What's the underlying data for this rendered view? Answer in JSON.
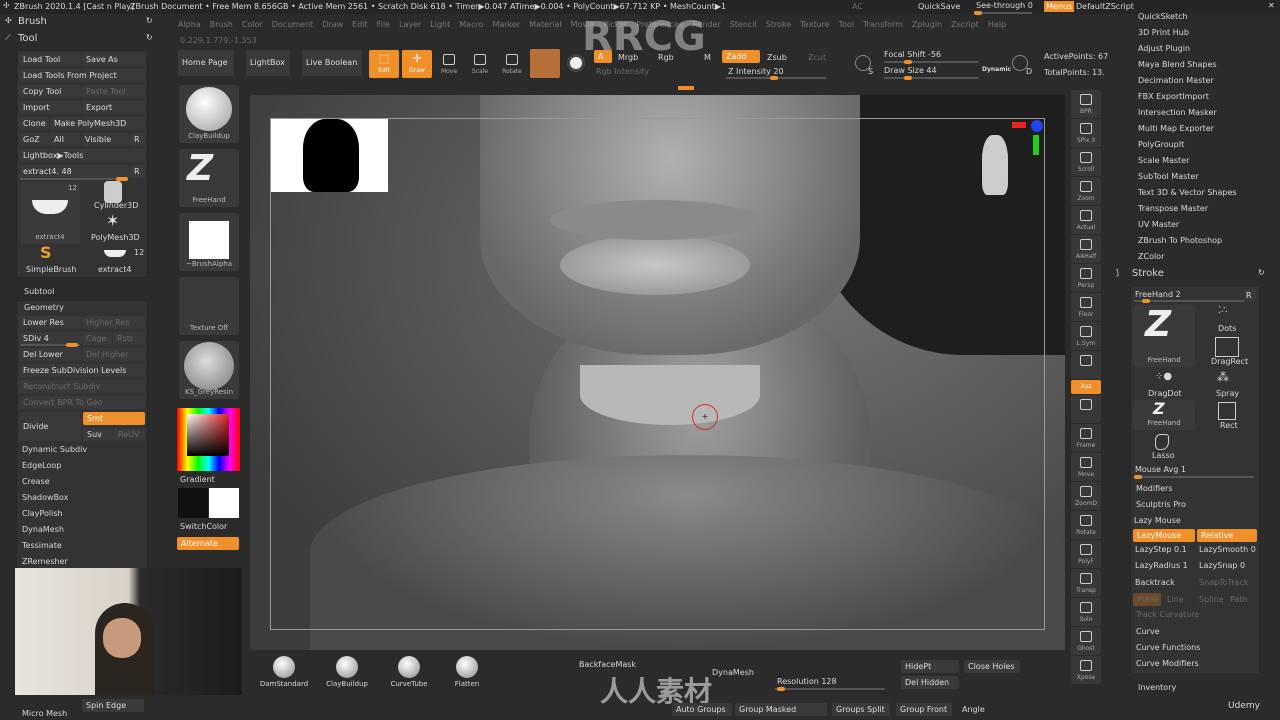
{
  "titlebar": {
    "app": "ZBrush 2020.1.4 [Cast n Play]",
    "doc": "ZBrush Document",
    "stats": "• Free Mem 8.656GB • Active Mem 2561 • Scratch Disk 618 • Timer▶0.047 ATime▶0.004 • PolyCount▶67.712 KP • MeshCount▶1",
    "ac": "AC",
    "quicksave": "QuickSave",
    "see_through": "See-through  0",
    "menus": "Menus",
    "script": "DefaultZScript"
  },
  "menu": [
    "Alpha",
    "Brush",
    "Color",
    "Document",
    "Draw",
    "Edit",
    "File",
    "Layer",
    "Light",
    "Macro",
    "Marker",
    "Material",
    "Movie",
    "Picker",
    "Preferences",
    "Render",
    "Stencil",
    "Stroke",
    "Texture",
    "Tool",
    "Transform",
    "Zplugin",
    "Zscript",
    "Help"
  ],
  "coords": "0.229,1.779,-1.353",
  "left": {
    "brush": "Brush",
    "tool": "Tool",
    "load_tool": "Load Tool",
    "save_as": "Save As",
    "load_project": "Load Tools From Project",
    "copy_tool": "Copy Tool",
    "paste_tool": "Paste Tool",
    "import": "Import",
    "export": "Export",
    "clone": "Clone",
    "make_polymesh": "Make PolyMesh3D",
    "goz": "GoZ",
    "all": "All",
    "visible": "Visible",
    "r": "R",
    "lightbox_tools": "Lightbox▶Tools",
    "extract": "extract4. 48",
    "tools": [
      {
        "label": "extract4",
        "count": "12"
      },
      {
        "label": "Cylinder3D"
      },
      {
        "label": "PolyMesh3D"
      },
      {
        "label": "SimpleBrush"
      },
      {
        "label": "extract4",
        "count": "12"
      }
    ],
    "subtool": "Subtool",
    "geometry": "Geometry",
    "lower_res": "Lower Res",
    "higher_res": "Higher Res",
    "sdiv": "SDiv 4",
    "cage": "Cage",
    "rstr": "Rstr",
    "del_lower": "Del Lower",
    "del_higher": "Del Higher",
    "freeze": "Freeze SubDivision Levels",
    "reconstruct": "Reconstruct Subdiv",
    "convert_bpr": "Convert BPR To Geo",
    "divide": "Divide",
    "smt": "Smt",
    "suv": "Suv",
    "reuv": "ReUV",
    "geo_list": [
      "Dynamic Subdiv",
      "EdgeLoop",
      "Crease",
      "ShadowBox",
      "ClayPolish",
      "DynaMesh",
      "Tessimate",
      "ZRemesher"
    ],
    "micro_mesh": "Micro Mesh",
    "spin_edge": "Spin Edge"
  },
  "top": {
    "home": "Home Page",
    "lightbox": "LightBox",
    "live_boolean": "Live Boolean",
    "edit": "Edit",
    "draw": "Draw",
    "move": "Move",
    "scale": "Scale",
    "rotate": "Rotate",
    "a": "A",
    "mrgb": "Mrgb",
    "rgb": "Rgb",
    "m": "M",
    "rgb_intensity": "Rgb Intensity",
    "zadd": "Zadd",
    "zsub": "Zsub",
    "zcut": "Zcut",
    "z_intensity": "Z Intensity 20",
    "focal_shift": "Focal Shift -56",
    "draw_size": "Draw Size 44",
    "dynamic": "Dynamic",
    "active_points": "ActivePoints: 67",
    "total_points": "TotalPoints: 13.",
    "s": "S",
    "d": "D"
  },
  "leftshelf": {
    "brush": "ClayBuildup",
    "stroke": "FreeHand",
    "alpha": "~BrushAlpha",
    "texture": "Texture Off",
    "material": "KS_GreyResin",
    "gradient": "Gradient",
    "switch": "SwitchColor",
    "alternate": "Alternate"
  },
  "rightshelf": [
    "BPR",
    "SPix 3",
    "Scroll",
    "Zoom",
    "Actual",
    "AAHalf",
    "Persp",
    "Floor",
    "L.Sym",
    "",
    "Xyz",
    "",
    "Frame",
    "Move",
    "ZoomD",
    "Rotate",
    "PolyF",
    "Transp",
    "Solo",
    "Ghost",
    "Xpose"
  ],
  "plugins": [
    "QuickSketch",
    "3D Print Hub",
    "Adjust Plugin",
    "Maya Blend Shapes",
    "Decimation Master",
    "FBX ExportImport",
    "Intersection Masker",
    "Multi Map Exporter",
    "PolyGroupIt",
    "Scale Master",
    "SubTool Master",
    "Text 3D & Vector Shapes",
    "Transpose Master",
    "UV Master",
    "ZBrush To Photoshop",
    "ZColor"
  ],
  "stroke": {
    "title": "Stroke",
    "freehand": "FreeHand  2",
    "r": "R",
    "types": [
      "FreeHand",
      "Dots",
      "DragRect",
      "DragDot",
      "Spray",
      "FreeHand",
      "Rect",
      "Lasso"
    ],
    "mouse_avg": "Mouse Avg 1",
    "modifiers": "Modifiers",
    "sculptris": "Sculptris Pro",
    "lazy_mouse": "Lazy Mouse",
    "lazymouse_btn": "LazyMouse",
    "relative": "Relative",
    "lazystep": "LazyStep 0.1",
    "lazysmooth": "LazySmooth 0",
    "lazyradius": "LazyRadius 1",
    "lazysnap": "LazySnap 0",
    "backtrack": "Backtrack",
    "snaptotrack": "SnapToTrack",
    "plane": "Plane",
    "line": "Line",
    "spline": "Spline",
    "path": "Path",
    "track_curvature": "Track Curvature",
    "curve": "Curve",
    "curve_functions": "Curve Functions",
    "curve_modifiers": "Curve Modifiers",
    "inventory": "Inventory"
  },
  "bottom": {
    "brushes": [
      "DamStandard",
      "ClayBuildup",
      "CurveTube",
      "Flatten"
    ],
    "backface": "BackfaceMask",
    "dynamesh": "DynaMesh",
    "resolution": "Resolution 128",
    "hidept": "HidePt",
    "close_holes": "Close Holes",
    "del_hidden": "Del Hidden",
    "auto_groups": "Auto Groups",
    "group_masked": "Group Masked",
    "groups_split": "Groups Split",
    "group_front": "Group Front",
    "angle": "Angle"
  },
  "watermark": "RRCG",
  "logo": "人人素材",
  "udemy": "Udemy",
  "colors": {
    "accent": "#f0902a",
    "bg": "#2b2b2b",
    "panel": "#333333"
  }
}
